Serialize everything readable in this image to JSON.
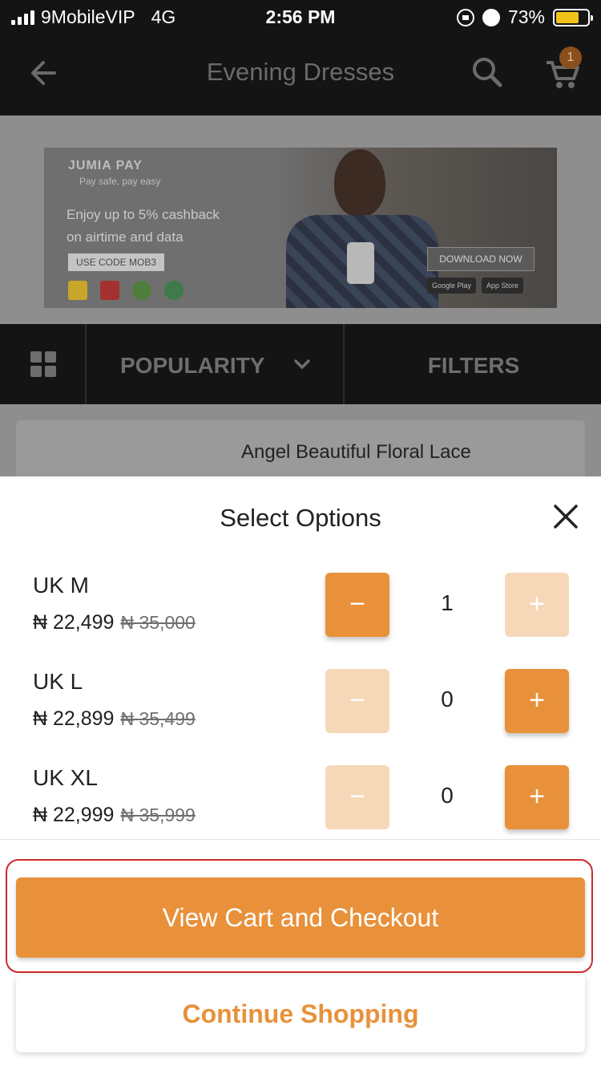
{
  "status_bar": {
    "carrier": "9MobileVIP",
    "network": "4G",
    "time": "2:56 PM",
    "battery": "73%",
    "battery_level": 0.73,
    "icons": [
      "signal-icon",
      "orientation-lock-icon",
      "alarm-icon",
      "battery-icon"
    ]
  },
  "app_bar": {
    "title": "Evening Dresses",
    "cart_count": "1",
    "icons": [
      "back-arrow-icon",
      "search-icon",
      "cart-icon"
    ]
  },
  "banner": {
    "brand": "JUMIA PAY",
    "tagline": "Pay safe, pay easy",
    "promo_line1": "Enjoy up to 5% cashback",
    "promo_line2": "on airtime and data",
    "code_label": "USE CODE MOB3",
    "download_label": "DOWNLOAD NOW",
    "google_play": "Google Play",
    "app_store": "App Store"
  },
  "sort_bar": {
    "sort_label": "POPULARITY",
    "filters_label": "FILTERS"
  },
  "product": {
    "title": "Angel Beautiful Floral Lace"
  },
  "sheet": {
    "title": "Select Options",
    "options": [
      {
        "size": "UK M",
        "price": "₦ 22,499",
        "old_price": "₦ 35,000",
        "quantity": "1"
      },
      {
        "size": "UK L",
        "price": "₦ 22,899",
        "old_price": "₦ 35,499",
        "quantity": "0"
      },
      {
        "size": "UK XL",
        "price": "₦ 22,999",
        "old_price": "₦ 35,999",
        "quantity": "0"
      }
    ],
    "minus_symbol": "−",
    "plus_symbol": "+",
    "checkout_label": "View Cart and Checkout",
    "continue_label": "Continue Shopping"
  },
  "colors": {
    "accent": "#e8913a",
    "accent_disabled": "#f6d8b9",
    "highlight_border": "#cc2a2a",
    "app_bar": "#141414"
  }
}
